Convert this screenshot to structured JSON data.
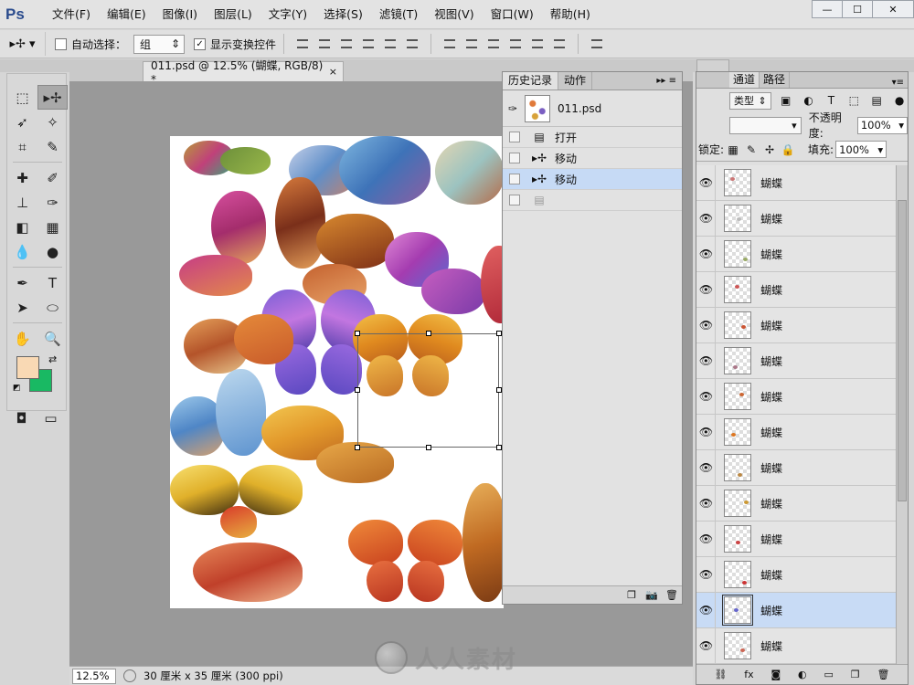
{
  "app": {
    "logo": "Ps"
  },
  "menu": [
    "文件(F)",
    "编辑(E)",
    "图像(I)",
    "图层(L)",
    "文字(Y)",
    "选择(S)",
    "滤镜(T)",
    "视图(V)",
    "窗口(W)",
    "帮助(H)"
  ],
  "window_controls": {
    "minimize": "—",
    "maximize": "☐",
    "close": "✕"
  },
  "options": {
    "auto_select_label": "自动选择：",
    "auto_select_value": "组",
    "show_transform_label": "显示变换控件",
    "auto_select_checked": false,
    "show_transform_checked": true
  },
  "document": {
    "tab_title": "011.psd @ 12.5% (蝴蝶, RGB/8) *",
    "close": "×"
  },
  "colors": {
    "foreground": "#f9d9b4",
    "background": "#19b963",
    "selection": "#c6daf5"
  },
  "status": {
    "zoom": "12.5%",
    "doc_size": "30 厘米 x 35 厘米 (300 ppi)"
  },
  "history_panel": {
    "tabs": [
      "历史记录",
      "动作"
    ],
    "snapshot_name": "011.psd",
    "states": [
      {
        "label": "打开",
        "icon": "document-icon",
        "selected": false,
        "dim": false
      },
      {
        "label": "移动",
        "icon": "move-icon",
        "selected": false,
        "dim": false
      },
      {
        "label": "移动",
        "icon": "move-icon",
        "selected": true,
        "dim": false
      },
      {
        "label": "",
        "icon": "document-icon",
        "selected": false,
        "dim": true
      }
    ]
  },
  "layers_panel": {
    "tabs": [
      "通道",
      "路径"
    ],
    "kind_label": "类型",
    "opacity_label": "不透明度:",
    "opacity_value": "100%",
    "lock_label": "锁定:",
    "fill_label": "填充:",
    "fill_value": "100%",
    "layers": [
      {
        "name": "蝴蝶",
        "selected": false,
        "thumb_color": "#c77"
      },
      {
        "name": "蝴蝶",
        "selected": false,
        "thumb_color": "#bbb"
      },
      {
        "name": "蝴蝶",
        "selected": false,
        "thumb_color": "#9a6"
      },
      {
        "name": "蝴蝶",
        "selected": false,
        "thumb_color": "#c55"
      },
      {
        "name": "蝴蝶",
        "selected": false,
        "thumb_color": "#c53"
      },
      {
        "name": "蝴蝶",
        "selected": false,
        "thumb_color": "#a78"
      },
      {
        "name": "蝴蝶",
        "selected": false,
        "thumb_color": "#c63"
      },
      {
        "name": "蝴蝶",
        "selected": false,
        "thumb_color": "#d72"
      },
      {
        "name": "蝴蝶",
        "selected": false,
        "thumb_color": "#b84"
      },
      {
        "name": "蝴蝶",
        "selected": false,
        "thumb_color": "#c93"
      },
      {
        "name": "蝴蝶",
        "selected": false,
        "thumb_color": "#c44"
      },
      {
        "name": "蝴蝶",
        "selected": false,
        "thumb_color": "#c33"
      },
      {
        "name": "蝴蝶",
        "selected": true,
        "thumb_color": "#66c"
      },
      {
        "name": "蝴蝶",
        "selected": false,
        "thumb_color": "#c65"
      }
    ]
  },
  "watermark": {
    "text": "人人素材"
  }
}
